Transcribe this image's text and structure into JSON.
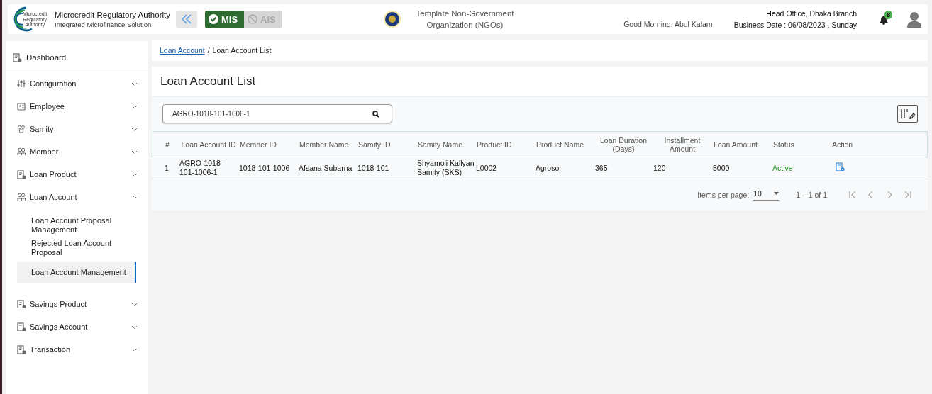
{
  "header": {
    "logo_text": [
      "Microcredit",
      "Regulatory",
      "Authority"
    ],
    "org_name": "Microcredit Regulatory Authority",
    "org_tagline": "Integrated Microfinance Solution",
    "modules": [
      {
        "label": "MIS",
        "selected": true
      },
      {
        "label": "AIS",
        "selected": false
      }
    ],
    "organization": "Template Non-Government Organization (NGOs)",
    "greeting": "Good Morning, Abul Kalam",
    "branch": "Head Office, Dhaka Branch",
    "business_date": "Business Date : 06/08/2023 , Sunday",
    "notification_count": "8"
  },
  "sidebar": {
    "items": [
      {
        "label": "Dashboard",
        "kind": "link"
      },
      {
        "label": "Configuration",
        "kind": "group",
        "expanded": false
      },
      {
        "label": "Employee",
        "kind": "group",
        "expanded": false
      },
      {
        "label": "Samity",
        "kind": "group",
        "expanded": false
      },
      {
        "label": "Member",
        "kind": "group",
        "expanded": false
      },
      {
        "label": "Loan Product",
        "kind": "group",
        "expanded": false
      },
      {
        "label": "Loan Account",
        "kind": "group",
        "expanded": true,
        "children": [
          {
            "label": "Loan Account Proposal Management",
            "selected": false
          },
          {
            "label": "Rejected Loan Account Proposal",
            "selected": false
          },
          {
            "label": "Loan Account Management",
            "selected": true
          }
        ]
      },
      {
        "label": "Savings Product",
        "kind": "group",
        "expanded": false
      },
      {
        "label": "Savings Account",
        "kind": "group",
        "expanded": false
      },
      {
        "label": "Transaction",
        "kind": "group",
        "expanded": false
      }
    ]
  },
  "breadcrumb": {
    "items": [
      {
        "label": "Loan Account",
        "kind": "link"
      },
      {
        "label": "Loan Account List",
        "kind": "current"
      }
    ],
    "separator": "/"
  },
  "page_title": "Loan Account List",
  "search": {
    "value": "AGRO-1018-101-1006-1"
  },
  "table": {
    "columns": [
      {
        "label": "#",
        "kind": "text"
      },
      {
        "label": "Loan Account ID",
        "kind": "text"
      },
      {
        "label": "Member ID",
        "kind": "text"
      },
      {
        "label": "Member Name",
        "kind": "text"
      },
      {
        "label": "Samity ID",
        "kind": "text"
      },
      {
        "label": "Samity Name",
        "kind": "text"
      },
      {
        "label": "Product ID",
        "kind": "text"
      },
      {
        "label": "Product Name",
        "kind": "text"
      },
      {
        "label": "Loan Duration (Days)",
        "kind": "text"
      },
      {
        "label": "Installment Amount",
        "kind": "text"
      },
      {
        "label": "Loan Amount",
        "kind": "text"
      },
      {
        "label": "Status",
        "kind": "status"
      },
      {
        "label": "Action",
        "kind": "action"
      }
    ],
    "rows": [
      {
        "cells": [
          "1",
          "AGRO-1018-101-1006-1",
          "1018-101-1006",
          "Afsana Subarna",
          "1018-101",
          "Shyamoli Kallyan Samity (SKS)",
          "L0002",
          "Agrosor",
          "365",
          "120",
          "5000",
          "Active",
          ""
        ]
      }
    ]
  },
  "pagination": {
    "items_per_page_label": "Items per page:",
    "page_size": "10",
    "range": "1 – 1 of 1",
    "buttons": [
      {
        "disabled": true
      },
      {
        "disabled": true
      },
      {
        "disabled": true
      },
      {
        "disabled": true
      }
    ]
  }
}
